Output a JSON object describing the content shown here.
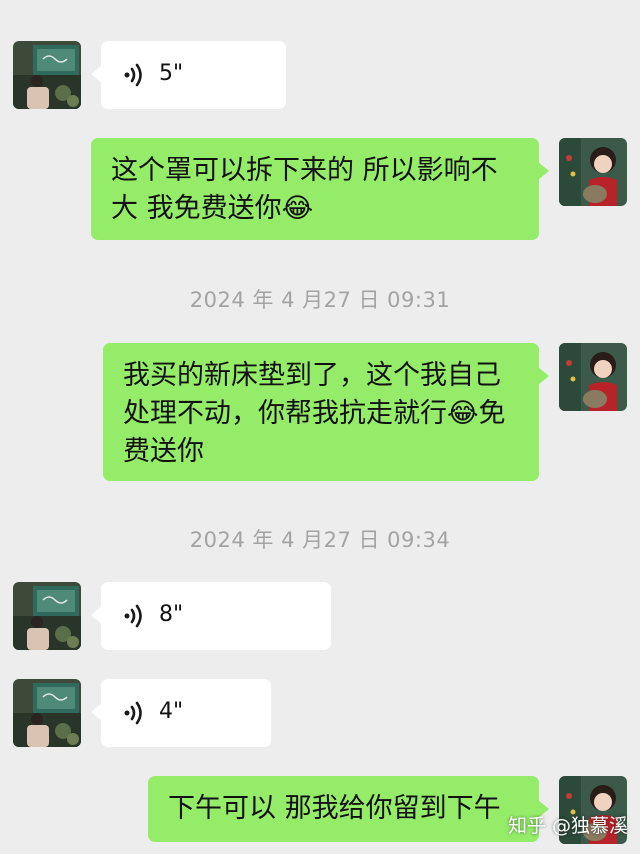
{
  "timestamps": [
    "2024 年 4 月27 日 09:31",
    "2024 年 4 月27 日 09:34"
  ],
  "messages": [
    {
      "side": "left",
      "type": "voice",
      "duration": "5\""
    },
    {
      "side": "right",
      "type": "text",
      "text": "这个罩可以拆下来的 所以影响不大 我免费送你😂"
    },
    {
      "side": "right",
      "type": "text",
      "text": "我买的新床垫到了，这个我自己处理不动，你帮我抗走就行😂免费送你"
    },
    {
      "side": "left",
      "type": "voice",
      "duration": "8\""
    },
    {
      "side": "left",
      "type": "voice",
      "duration": "4\""
    },
    {
      "side": "right",
      "type": "text",
      "text": "下午可以 那我给你留到下午"
    }
  ],
  "watermark": "知乎 @独慕溪",
  "colors": {
    "background": "#ededed",
    "self_bubble": "#95ec69",
    "other_bubble": "#ffffff",
    "timestamp": "#a3a3a3"
  }
}
